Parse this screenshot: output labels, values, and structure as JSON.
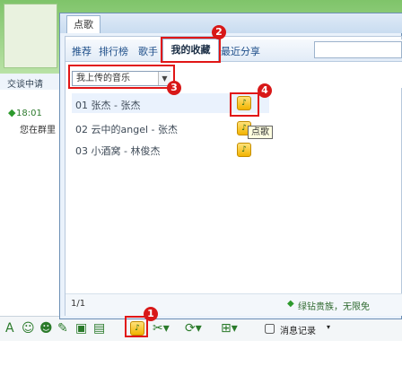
{
  "popup": {
    "title_tab": "点歌",
    "tabs": [
      "推荐",
      "排行榜",
      "歌手",
      "我的收藏",
      "最近分享"
    ],
    "selected_tab": "我的收藏",
    "category_select": "我上传的音乐",
    "songs": [
      {
        "label": "01 张杰 - 张杰"
      },
      {
        "label": "02 云中的angel - 张杰"
      },
      {
        "label": "03 小酒窝 - 林俊杰"
      }
    ],
    "tooltip": "点歌",
    "page_indicator": "1/1",
    "promo_text": "绿钻贵族，无限免"
  },
  "annotations": [
    "1",
    "2",
    "3",
    "4"
  ],
  "chat": {
    "tip_text": "交谈中请",
    "time": "18:01",
    "message": "您在群里"
  },
  "toolbar": {
    "history_label": "消息记录"
  },
  "colors": {
    "annotation_red": "#e11616",
    "accent_blue": "#1f4f8a",
    "brand_green": "#2d7a2d"
  }
}
